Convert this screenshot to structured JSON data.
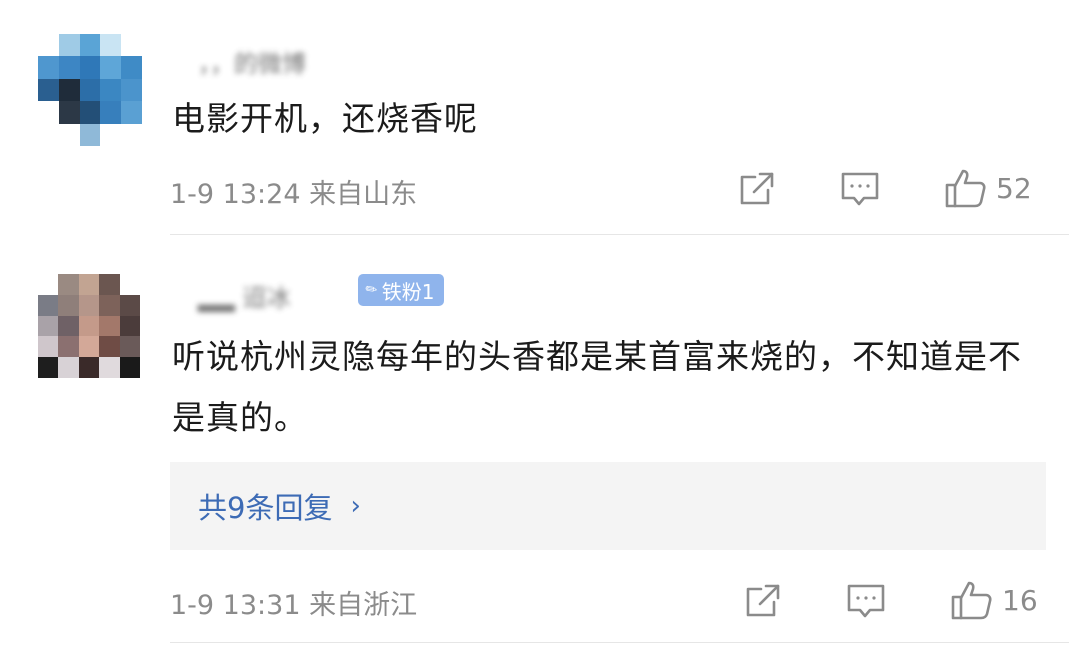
{
  "comments": [
    {
      "username": "，，的微博",
      "badge": "",
      "text": "电影开机，还烧香呢",
      "time": "1-9 13:24",
      "location": "来自山东",
      "likes": "52",
      "replies_label": ""
    },
    {
      "username": "▂▂  迢冰",
      "badge": "铁粉1",
      "text": "听说杭州灵隐每年的头香都是某首富来烧的，不知道是不是真的。",
      "time": "1-9 13:31",
      "location": "来自浙江",
      "likes": "16",
      "replies_label": "共9条回复"
    }
  ],
  "icons": {
    "share": "share-icon",
    "reply": "comment-icon",
    "like": "thumbs-up-icon",
    "chevron": "chevron-right-icon",
    "badge": "pen-icon"
  },
  "colors": {
    "link": "#3d6bb5",
    "badge_bg": "#8fb4ec",
    "meta_text": "#8b8b8b",
    "reply_box_bg": "#f4f4f4"
  }
}
